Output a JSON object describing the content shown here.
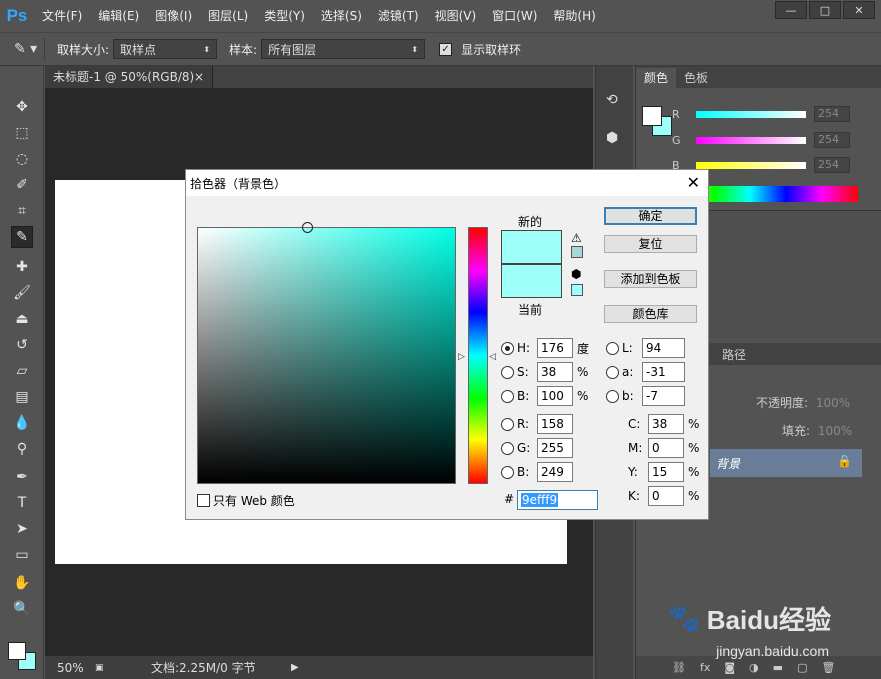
{
  "app": {
    "logo": "Ps"
  },
  "menu": [
    "文件(F)",
    "编辑(E)",
    "图像(I)",
    "图层(L)",
    "类型(Y)",
    "选择(S)",
    "滤镜(T)",
    "视图(V)",
    "窗口(W)",
    "帮助(H)"
  ],
  "window_buttons": {
    "minimize": "—",
    "maximize": "□",
    "close": "✕"
  },
  "options": {
    "sample_size_label": "取样大小:",
    "sample_size_value": "取样点",
    "sample_label": "样本:",
    "sample_value": "所有图层",
    "show_ring_label": "显示取样环",
    "show_ring_checked": true
  },
  "document": {
    "tab_title": "未标题-1 @ 50%(RGB/8)",
    "tab_close": "×",
    "zoom": "50%",
    "doc_info": "文档:2.25M/0 字节"
  },
  "panels": {
    "color_tab": "颜色",
    "swatches_tab": "色板",
    "r_label": "R",
    "g_label": "G",
    "b_label": "B",
    "r_value": "254",
    "g_value": "254",
    "b_value": "254",
    "paths_tab": "路径",
    "opacity_label": "不透明度:",
    "opacity_value": "100%",
    "fill_label": "填充:",
    "fill_value": "100%",
    "layer_name": "背景"
  },
  "dialog": {
    "title": "拾色器（背景色）",
    "close": "✕",
    "new_label": "新的",
    "current_label": "当前",
    "ok": "确定",
    "reset": "复位",
    "add_to_swatches": "添加到色板",
    "color_libraries": "颜色库",
    "web_only": "只有 Web 颜色",
    "hsb": [
      {
        "label": "H:",
        "value": "176",
        "unit": "度",
        "selected": true
      },
      {
        "label": "S:",
        "value": "38",
        "unit": "%",
        "selected": false
      },
      {
        "label": "B:",
        "value": "100",
        "unit": "%",
        "selected": false
      }
    ],
    "rgb": [
      {
        "label": "R:",
        "value": "158"
      },
      {
        "label": "G:",
        "value": "255"
      },
      {
        "label": "B:",
        "value": "249"
      }
    ],
    "lab": [
      {
        "label": "L:",
        "value": "94"
      },
      {
        "label": "a:",
        "value": "-31"
      },
      {
        "label": "b:",
        "value": "-7"
      }
    ],
    "cmyk": [
      {
        "label": "C:",
        "value": "38",
        "unit": "%"
      },
      {
        "label": "M:",
        "value": "0",
        "unit": "%"
      },
      {
        "label": "Y:",
        "value": "15",
        "unit": "%"
      },
      {
        "label": "K:",
        "value": "0",
        "unit": "%"
      }
    ],
    "hex_label": "#",
    "hex_value": "9efff9",
    "new_color": "#9efff9",
    "current_color": "#9efff9"
  },
  "watermark": {
    "brand": "Baidu经验",
    "url": "jingyan.baidu.com"
  }
}
